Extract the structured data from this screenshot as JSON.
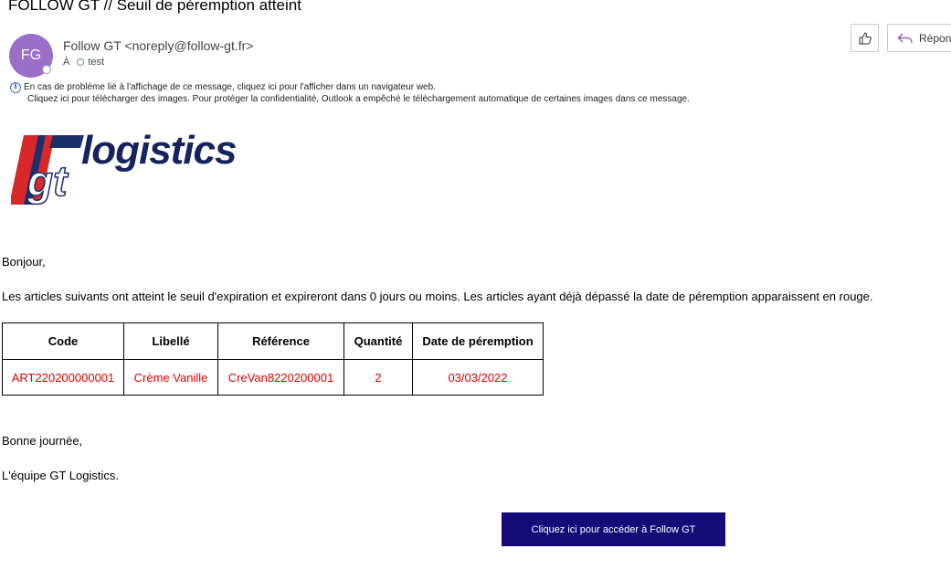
{
  "email": {
    "subject": "FOLLOW GT // Seuil de péremption atteint",
    "avatar_initials": "FG",
    "avatar_color": "#9b6ec8",
    "sender": "Follow GT <noreply@follow-gt.fr>",
    "to_label": "À",
    "to_recipient": "test",
    "actions": {
      "like_icon": "thumbs-up-icon",
      "reply_label": "Répon"
    },
    "info_bar": {
      "icon": "info-icon",
      "line1": "En cas de problème lié à l'affichage de ce message, cliquez ici pour l'afficher dans un navigateur web.",
      "line2": "Cliquez ici pour télécharger des images. Pour protéger la confidentialité, Outlook a empêché le téléchargement automatique de certaines images dans ce message."
    }
  },
  "content": {
    "logo_text": "logistics",
    "logo_mark": "gt",
    "greeting": "Bonjour,",
    "intro": "Les articles suivants ont atteint le seuil d'expiration et expireront dans 0 jours ou moins. Les articles ayant déjà dépassé la date de péremption apparaissent en rouge.",
    "table": {
      "headers": [
        "Code",
        "Libellé",
        "Référence",
        "Quantité",
        "Date de péremption"
      ],
      "rows": [
        [
          "ART220200000001",
          "Crème Vanille",
          "CreVan8220200001",
          "2",
          "03/03/2022"
        ]
      ],
      "expired_color": "#e00000"
    },
    "closing": "Bonne journée,",
    "signature": "L'équipe GT Logistics.",
    "cta_label": "Cliquez ici pour accéder à Follow GT",
    "cta_color": "#140a78"
  }
}
